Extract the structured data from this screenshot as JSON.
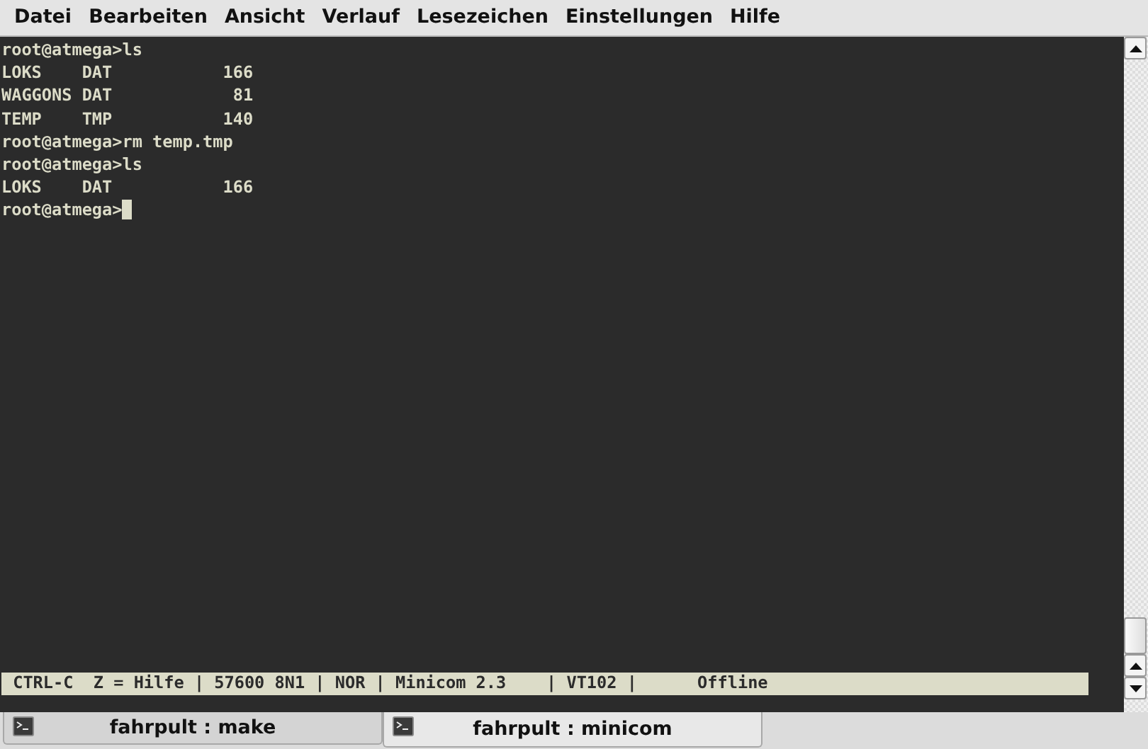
{
  "menu": [
    "Datei",
    "Bearbeiten",
    "Ansicht",
    "Verlauf",
    "Lesezeichen",
    "Einstellungen",
    "Hilfe"
  ],
  "terminal": {
    "lines": [
      "root@atmega>ls",
      "LOKS    DAT           166",
      "WAGGONS DAT            81",
      "TEMP    TMP           140",
      "root@atmega>rm temp.tmp",
      "root@atmega>ls",
      "LOKS    DAT           166",
      "root@atmega>"
    ]
  },
  "status_line": " CTRL-C  Z = Hilfe | 57600 8N1 | NOR | Minicom 2.3    | VT102 |      Offline",
  "tabs": [
    {
      "label": "fahrpult : make",
      "selected": false
    },
    {
      "label": "fahrpult : minicom",
      "selected": true
    }
  ]
}
